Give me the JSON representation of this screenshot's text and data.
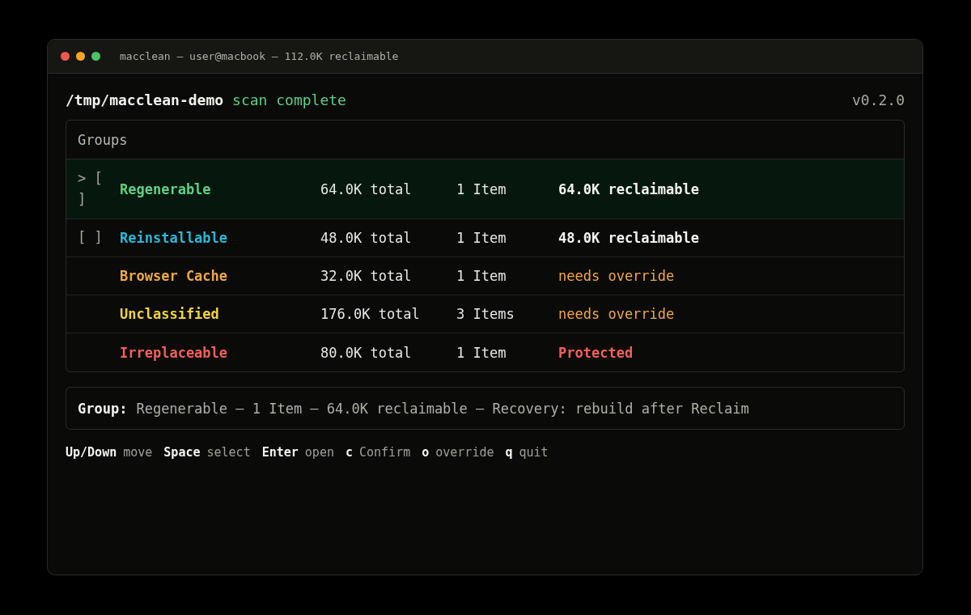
{
  "window": {
    "title": "macclean — user@macbook — 112.0K reclaimable"
  },
  "header": {
    "path": "/tmp/macclean-demo",
    "status": "scan complete",
    "version": "v0.2.0"
  },
  "groups": {
    "title": "Groups",
    "rows": [
      {
        "marker": "> [ ]",
        "name": "Regenerable",
        "color": "#5fcf84",
        "total": "64.0K total",
        "items": "1 Item",
        "status": "64.0K reclaimable",
        "kind": "reclaimable",
        "selected": true
      },
      {
        "marker": "[ ]",
        "name": "Reinstallable",
        "color": "#2bb8d6",
        "total": "48.0K total",
        "items": "1 Item",
        "status": "48.0K reclaimable",
        "kind": "reclaimable",
        "selected": false
      },
      {
        "name": "Browser Cache",
        "color": "#f0a848",
        "total": "32.0K total",
        "items": "1 Item",
        "status": "needs override",
        "kind": "override",
        "selected": false
      },
      {
        "name": "Unclassified",
        "color": "#f2d33c",
        "total": "176.0K total",
        "items": "3 Items",
        "status": "needs override",
        "kind": "override",
        "selected": false
      },
      {
        "name": "Irreplaceable",
        "color": "#f0605a",
        "total": "80.0K total",
        "items": "1 Item",
        "status": "Protected",
        "kind": "protected",
        "selected": false
      }
    ]
  },
  "detail": {
    "label": "Group:",
    "text": "Regenerable — 1 Item — 64.0K reclaimable — Recovery: rebuild after Reclaim"
  },
  "keys": [
    {
      "key": "Up/Down",
      "action": "move"
    },
    {
      "key": "Space",
      "action": "select"
    },
    {
      "key": "Enter",
      "action": "open"
    },
    {
      "key": "c",
      "action": "Confirm"
    },
    {
      "key": "o",
      "action": "override"
    },
    {
      "key": "q",
      "action": "quit"
    }
  ]
}
